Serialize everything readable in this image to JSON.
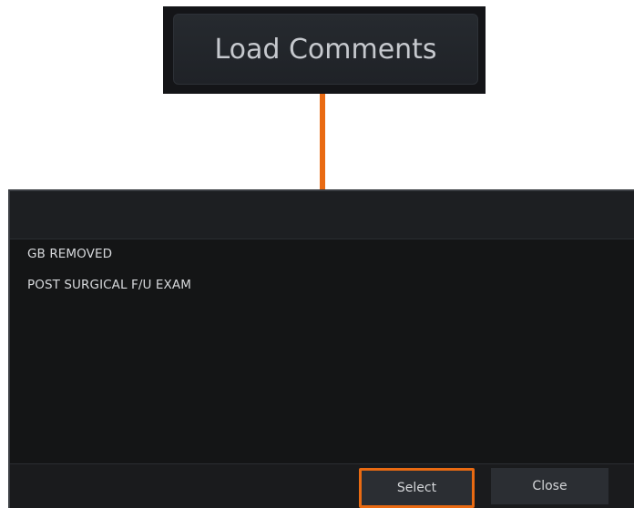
{
  "callout": {
    "button_label": "Load Comments"
  },
  "dialog": {
    "title": "",
    "comments": [
      "GB REMOVED",
      "POST SURGICAL F/U EXAM"
    ],
    "select_label": "Select",
    "close_label": "Close"
  },
  "colors": {
    "highlight": "#e96a12",
    "background": "#161719"
  }
}
